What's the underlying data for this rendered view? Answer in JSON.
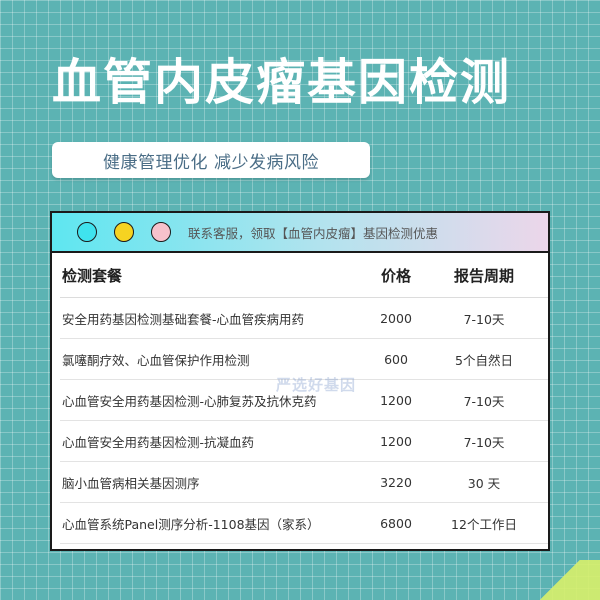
{
  "header": {
    "title": "血管内皮瘤基因检测",
    "subtitle": "健康管理优化 减少发病风险"
  },
  "card": {
    "bar_text": "联系客服，领取【血管内皮瘤】基因检测优惠",
    "dots": [
      "#3fe3ee",
      "#f6d321",
      "#f7c2cc"
    ]
  },
  "table": {
    "columns": [
      "检测套餐",
      "价格",
      "报告周期"
    ],
    "rows": [
      {
        "name": "安全用药基因检测基础套餐-心血管疾病用药",
        "price": "2000",
        "period": "7-10天"
      },
      {
        "name": "氯噻酮疗效、心血管保护作用检测",
        "price": "600",
        "period": "5个自然日"
      },
      {
        "name": "心血管安全用药基因检测-心肺复苏及抗休克药",
        "price": "1200",
        "period": "7-10天"
      },
      {
        "name": "心血管安全用药基因检测-抗凝血药",
        "price": "1200",
        "period": "7-10天"
      },
      {
        "name": "脑小血管病相关基因测序",
        "price": "3220",
        "period": "30 天"
      },
      {
        "name": "心血管系统Panel测序分析-1108基因（家系）",
        "price": "6800",
        "period": "12个工作日"
      }
    ]
  },
  "watermark": "严选好基因",
  "colors": {
    "background": "#5cb3b3",
    "title": "#ffffff",
    "subtitle": "#4a6d86"
  }
}
